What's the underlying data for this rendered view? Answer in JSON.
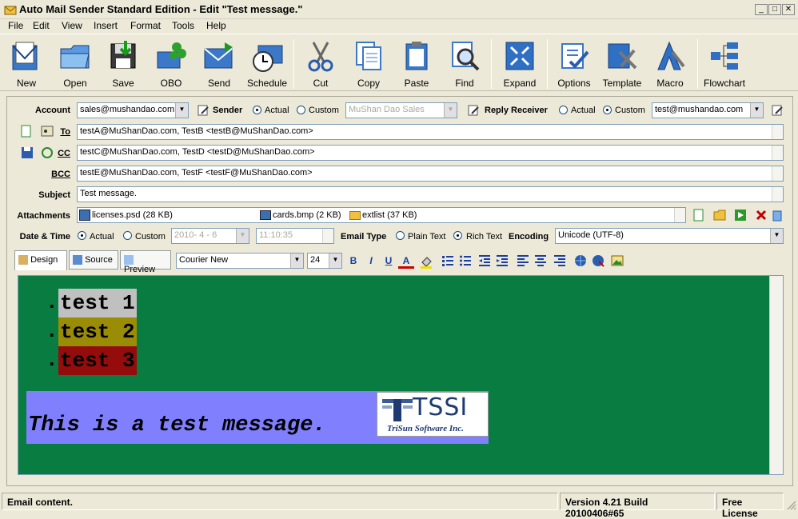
{
  "window": {
    "title": "Auto Mail Sender Standard Edition - Edit \"Test message.\"",
    "controls": [
      "_",
      "□",
      "✕"
    ]
  },
  "menu": [
    "File",
    "Edit",
    "View",
    "Insert",
    "Format",
    "Tools",
    "Help"
  ],
  "toolbar": [
    {
      "label": "New",
      "icon": "new-mail-icon"
    },
    {
      "label": "Open",
      "icon": "open-folder-icon"
    },
    {
      "label": "Save",
      "icon": "save-icon"
    },
    {
      "label": "OBO",
      "icon": "obo-icon"
    },
    {
      "label": "Send",
      "icon": "send-icon"
    },
    {
      "label": "Schedule",
      "icon": "schedule-icon"
    },
    {
      "label": "Cut",
      "icon": "cut-icon"
    },
    {
      "label": "Copy",
      "icon": "copy-icon"
    },
    {
      "label": "Paste",
      "icon": "paste-icon"
    },
    {
      "label": "Find",
      "icon": "find-icon"
    },
    {
      "label": "Expand",
      "icon": "expand-icon"
    },
    {
      "label": "Options",
      "icon": "options-icon"
    },
    {
      "label": "Template",
      "icon": "template-icon"
    },
    {
      "label": "Macro",
      "icon": "macro-icon"
    },
    {
      "label": "Flowchart",
      "icon": "flowchart-icon"
    }
  ],
  "form": {
    "account_label": "Account",
    "account_value": "sales@mushandao.com",
    "sender_label": "Sender",
    "sender_actual": "Actual",
    "sender_custom": "Custom",
    "sender_custom_value": "MuShan Dao Sales",
    "reply_label": "Reply Receiver",
    "reply_actual": "Actual",
    "reply_custom": "Custom",
    "reply_value": "test@mushandao.com",
    "to_label": "To",
    "to_value": "testA@MuShanDao.com, TestB <testB@MuShanDao.com>",
    "cc_label": "CC",
    "cc_value": "testC@MuShanDao.com, TestD <testD@MuShanDao.com>",
    "bcc_label": "BCC",
    "bcc_value": "testE@MuShanDao.com, TestF <testF@MuShanDao.com>",
    "subject_label": "Subject",
    "subject_value": "Test message.",
    "attachments_label": "Attachments",
    "attachments": [
      "licenses.psd (28 KB)",
      "cards.bmp (2 KB)",
      "extlist (37 KB)"
    ],
    "datetime_label": "Date & Time",
    "dt_actual": "Actual",
    "dt_custom": "Custom",
    "date_value": "2010- 4 - 6",
    "time_value": "11:10:35",
    "emailtype_label": "Email Type",
    "plain_text": "Plain Text",
    "rich_text": "Rich Text",
    "encoding_label": "Encoding",
    "encoding_value": "Unicode (UTF-8)"
  },
  "editor_tabs": [
    "Design",
    "Source",
    "Preview"
  ],
  "format": {
    "font": "Courier New",
    "size": "24",
    "bold": "B",
    "italic": "I",
    "underline": "U",
    "fontcolor": "A"
  },
  "content": {
    "bullet": ".",
    "items": [
      "test 1",
      "test 2",
      "test 3"
    ],
    "message": "This is a test message.",
    "logo_main": "TSSI",
    "logo_sub": "TriSun Software Inc."
  },
  "colors": {
    "editor_bg": "#087c41",
    "item1_bg": "#c0c0c0",
    "item2_bg": "#9b8c05",
    "item3_bg": "#940c0c",
    "message_bg": "#8080ff",
    "logo_blue": "#1f3a73"
  },
  "status": {
    "left": "Email content.",
    "version": "Version 4.21 Build 20100406#65",
    "license": "Free License"
  }
}
